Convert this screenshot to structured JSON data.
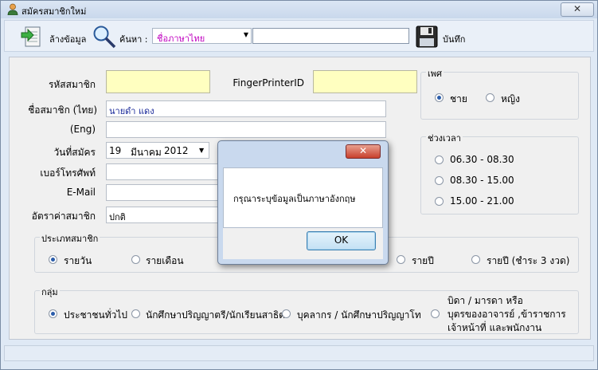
{
  "window": {
    "title": "สมัครสมาชิกใหม่",
    "close_glyph": "✕"
  },
  "toolbar": {
    "clear_label": "ล้างข้อมูล",
    "search_label": "ค้นหา :",
    "search_mode_value": "ชื่อภาษาไทย",
    "search_text": "",
    "save_label": "บันทึก"
  },
  "form": {
    "member_id_label": "รหัสสมาชิก",
    "member_id_value": "",
    "finger_label": "FingerPrinterID",
    "finger_value": "",
    "name_th_label": "ชื่อสมาชิก (ไทย)",
    "name_th_value": "นายดำ แดง",
    "name_en_label": "(Eng)",
    "name_en_value": "",
    "apply_date_label": "วันที่สมัคร",
    "apply_date": {
      "day": "19",
      "month": "มีนาคม",
      "year": "2012"
    },
    "phone_label": "เบอร์โทรศัพท์",
    "phone_value": "",
    "email_label": "E-Mail",
    "email_value": "",
    "fee_label": "อัตราค่าสมาชิก",
    "fee_value": "ปกติ"
  },
  "gender": {
    "title": "เพศ",
    "options": [
      {
        "label": "ชาย",
        "selected": true
      },
      {
        "label": "หญิง",
        "selected": false
      }
    ]
  },
  "time_slot": {
    "title": "ช่วงเวลา",
    "options": [
      {
        "label": "06.30 - 08.30",
        "selected": false
      },
      {
        "label": "08.30 - 15.00",
        "selected": false
      },
      {
        "label": "15.00 - 21.00",
        "selected": false
      }
    ]
  },
  "member_type": {
    "title": "ประเภทสมาชิก",
    "options": [
      {
        "label": "รายวัน",
        "selected": true
      },
      {
        "label": "รายเดือน",
        "selected": false
      },
      {
        "label": "รายปี",
        "selected": false
      },
      {
        "label": "รายปี (ชำระ 3 งวด)",
        "selected": false
      }
    ]
  },
  "group": {
    "title": "กลุ่ม",
    "options": [
      {
        "label": "ประชาชนทั่วไป",
        "selected": true
      },
      {
        "label": "นักศึกษาปริญญาตรี/นักเรียนสาธิต",
        "selected": false
      },
      {
        "label": "บุคลากร / นักศึกษาปริญญาโท",
        "selected": false
      },
      {
        "label_lines": [
          "บิดา / มารดา หรือ",
          "บุตรของอาจารย์ ,ข้าราชการ",
          "เจ้าหน้าที่ และพนักงาน"
        ],
        "selected": false
      }
    ]
  },
  "dialog": {
    "title": "",
    "message": "กรุณาระบุข้อมูลเป็นภาษาอังกฤษ",
    "ok_label": "OK",
    "close_glyph": "✕"
  },
  "colors": {
    "accent_radio": "#2a5caa",
    "yellow_field": "#ffffc0",
    "search_mode_text": "#c000c0"
  }
}
